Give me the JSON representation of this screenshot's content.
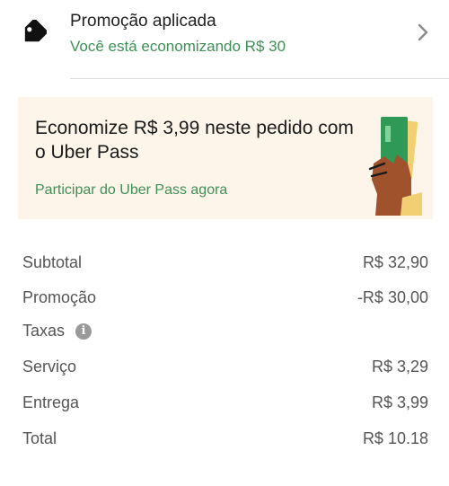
{
  "promo": {
    "title": "Promoção aplicada",
    "subtitle": "Você está economizando R$ 30"
  },
  "uber_pass": {
    "title": "Economize R$ 3,99 neste pedido com o Uber Pass",
    "link": "Participar do Uber Pass agora"
  },
  "summary": {
    "subtotal": {
      "label": "Subtotal",
      "value": "R$ 32,90"
    },
    "promocao": {
      "label": "Promoção",
      "value": "-R$ 30,00"
    },
    "taxas": {
      "label": "Taxas"
    },
    "servico": {
      "label": "Serviço",
      "value": "R$ 3,29"
    },
    "entrega": {
      "label": "Entrega",
      "value": "R$ 3,99"
    },
    "total": {
      "label": "Total",
      "value": "R$ 10.18"
    }
  },
  "colors": {
    "accent_green": "#3f8f57",
    "card_background": "#fdf5e9",
    "text_primary": "#1f1f1f",
    "text_secondary": "#555555"
  },
  "icons": {
    "promo": "tag-icon",
    "chevron": "chevron-right-icon",
    "info": "info-icon",
    "pass_illustration": "hand-holding-ticket-illustration"
  }
}
